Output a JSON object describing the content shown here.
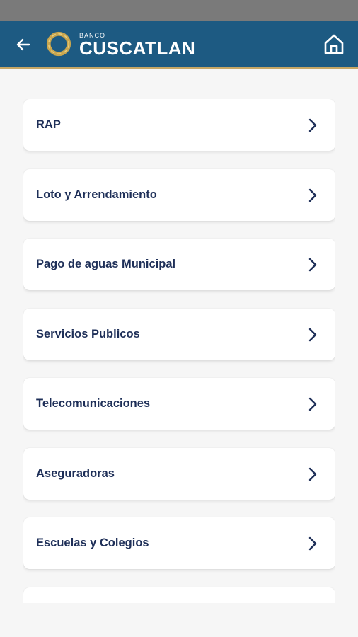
{
  "header": {
    "logo_small": "BANCO",
    "logo_big": "CUSCATLAN"
  },
  "colors": {
    "status_bar": "#7a7a7a",
    "app_bar": "#1d5a82",
    "accent_line": "#c7a765",
    "label_text": "#1e2f58"
  },
  "icons": {
    "back": "arrow-left-icon",
    "logo": "gold-ring-logo-icon",
    "home": "home-icon",
    "item": "chevron-right-icon"
  },
  "categories": [
    {
      "label": "RAP"
    },
    {
      "label": "Loto y Arrendamiento"
    },
    {
      "label": "Pago de aguas Municipal"
    },
    {
      "label": "Servicios Publicos"
    },
    {
      "label": "Telecomunicaciones"
    },
    {
      "label": "Aseguradoras"
    },
    {
      "label": "Escuelas y Colegios"
    }
  ]
}
